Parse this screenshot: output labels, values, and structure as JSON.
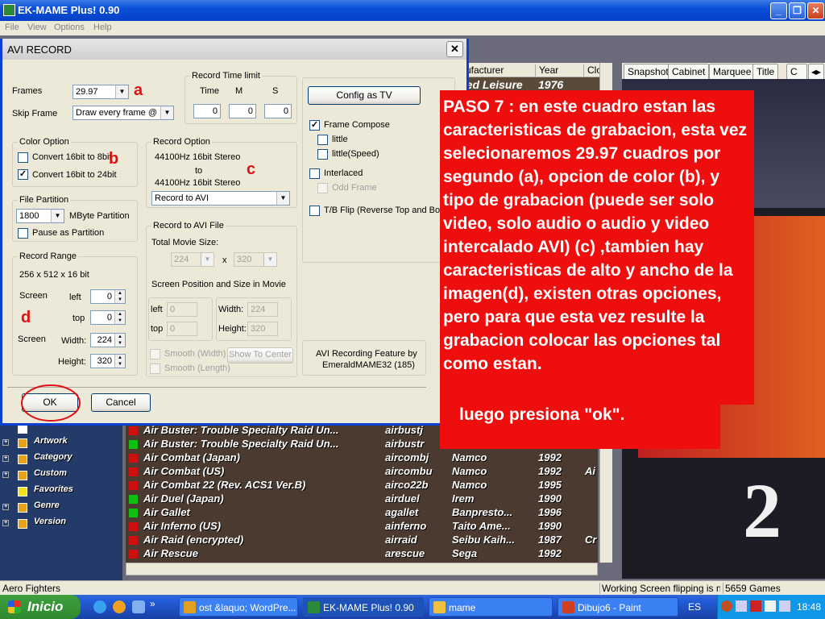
{
  "main": {
    "title": "EK-MAME Plus! 0.90",
    "menus": [
      "File",
      "View",
      "Options",
      "Help"
    ],
    "window_buttons": [
      "_",
      "❐",
      "✕"
    ]
  },
  "list": {
    "headers": [
      "ufacturer",
      "Year",
      "Clo"
    ],
    "top_row": {
      "manufacturer": "ted Leisure",
      "year": "1976"
    },
    "rows": [
      {
        "name": "Air Buster: Trouble Specialty Raid Un...",
        "rom": "airbustj",
        "maker": "",
        "year": "",
        "extra": "",
        "color": "#d01010"
      },
      {
        "name": "Air Buster: Trouble Specialty Raid Un...",
        "rom": "airbustr",
        "maker": "",
        "year": "",
        "extra": "",
        "color": "#10c010"
      },
      {
        "name": "Air Combat (Japan)",
        "rom": "aircombj",
        "maker": "Namco",
        "year": "1992",
        "extra": "",
        "color": "#d01010"
      },
      {
        "name": "Air Combat (US)",
        "rom": "aircombu",
        "maker": "Namco",
        "year": "1992",
        "extra": "Ai",
        "color": "#d01010"
      },
      {
        "name": "Air Combat 22 (Rev. ACS1 Ver.B)",
        "rom": "airco22b",
        "maker": "Namco",
        "year": "1995",
        "extra": "",
        "color": "#d01010"
      },
      {
        "name": "Air Duel (Japan)",
        "rom": "airduel",
        "maker": "Irem",
        "year": "1990",
        "extra": "",
        "color": "#10c010"
      },
      {
        "name": "Air Gallet",
        "rom": "agallet",
        "maker": "Banpresto...",
        "year": "1996",
        "extra": "",
        "color": "#10c010"
      },
      {
        "name": "Air Inferno (US)",
        "rom": "ainferno",
        "maker": "Taito Ame...",
        "year": "1990",
        "extra": "",
        "color": "#d01010"
      },
      {
        "name": "Air Raid (encrypted)",
        "rom": "airraid",
        "maker": "Seibu Kaih...",
        "year": "1987",
        "extra": "Cr",
        "color": "#d01010"
      },
      {
        "name": "Air Rescue",
        "rom": "arescue",
        "maker": "Sega",
        "year": "1992",
        "extra": "",
        "color": "#d01010"
      }
    ]
  },
  "tree": {
    "items": [
      {
        "label": "Artwork",
        "expand": "+"
      },
      {
        "label": "Category",
        "expand": "+"
      },
      {
        "label": "Custom",
        "expand": "+"
      },
      {
        "label": "Favorites",
        "expand": ""
      },
      {
        "label": "Genre",
        "expand": "+"
      },
      {
        "label": "Version",
        "expand": "+"
      }
    ]
  },
  "art_tabs": [
    "Snapshot",
    "Cabinet",
    "Marquee",
    "Title",
    "C"
  ],
  "status": {
    "left": "Aero Fighters",
    "working": "Working  Screen flipping is not s",
    "games": "5659 Games"
  },
  "taskbar": {
    "start": "Inicio",
    "tasks": [
      {
        "label": "ost &laquo; WordPre...",
        "color": "#e0a020"
      },
      {
        "label": "EK-MAME Plus! 0.90",
        "color": "#2a8a3a"
      },
      {
        "label": "mame",
        "color": "#f0c040"
      },
      {
        "label": "Dibujo6 - Paint",
        "color": "#d04020"
      }
    ],
    "lang": "ES",
    "clock": "18:48"
  },
  "dialog": {
    "title": "AVI RECORD",
    "frames_label": "Frames",
    "frames_value": "29.97",
    "skip_label": "Skip Frame",
    "skip_value": "Draw every frame  @",
    "time_group": "Record Time limit",
    "time_heads": [
      "Time",
      "M",
      "S"
    ],
    "time_values": [
      "0",
      "0",
      "0"
    ],
    "color_group": "Color Option",
    "color_opt1": "Convert 16bit to 8bit",
    "color_opt2": "Convert 16bit to 24bit",
    "record_group": "Record Option",
    "record_from": "44100Hz 16bit Stereo",
    "record_to_word": "to",
    "record_to": "44100Hz 16bit Stereo",
    "record_mode": "Record to AVI",
    "partition_group": "File Partition",
    "partition_value": "1800",
    "partition_unit": "MByte Partition",
    "pause_label": "Pause as Partition",
    "avi_file_group": "Record to AVI File",
    "movie_size_label": "Total Movie Size:",
    "movie_w": "224",
    "movie_x": "x",
    "movie_h": "320",
    "screen_pos_label": "Screen Position and Size in Movie",
    "pos_left_label": "left",
    "pos_left_value": "0",
    "pos_top_label": "top",
    "pos_top_value": "0",
    "pos_width_label": "Width:",
    "pos_width_value": "224",
    "pos_height_label": "Height:",
    "pos_height_value": "320",
    "smooth_width": "Smooth (Width)",
    "smooth_length": "Smooth (Length)",
    "show_center": "Show To Center",
    "range_group": "Record Range",
    "range_info": "256 x 512 x 16 bit",
    "screen_label": "Screen",
    "left_label": "left",
    "left_value": "0",
    "top_label": "top",
    "top_value": "0",
    "screen2_label": "Screen",
    "width_label": "Width:",
    "width_value": "224",
    "height_label": "Height:",
    "height_value": "320",
    "config_tv": "Config as TV",
    "frame_compose": "Frame Compose",
    "little": "little",
    "little_speed": "little(Speed)",
    "interlaced": "Interlaced",
    "odd_frame": "Odd Frame",
    "tb_flip": "T/B Flip (Reverse Top and Bot",
    "feature_line1": "AVI Recording Feature by",
    "feature_line2": "EmeraldMAME32 (185)",
    "ok": "OK",
    "cancel": "Cancel",
    "letters": {
      "a": "a",
      "b": "b",
      "c": "c",
      "d": "d"
    }
  },
  "annotation": {
    "text": "PASO 7 : en este cuadro estan las caracteristicas de grabacion, esta vez selecionaremos 29.97 cuadros por segundo (a), opcion de color (b), y tipo de grabacion (puede ser solo video, solo audio o audio y video intercalado AVI) (c) ,tambien hay caracteristicas de alto y ancho de la imagen(d), existen otras opciones, pero para que esta vez resulte la grabacion colocar las opciones tal como estan.",
    "ok_line": "luego presiona \"ok\"."
  },
  "colors": {
    "annotation": "#ef0e0e",
    "titlebar": "#0a4fd8",
    "dialog_bg": "#ece9d8"
  }
}
